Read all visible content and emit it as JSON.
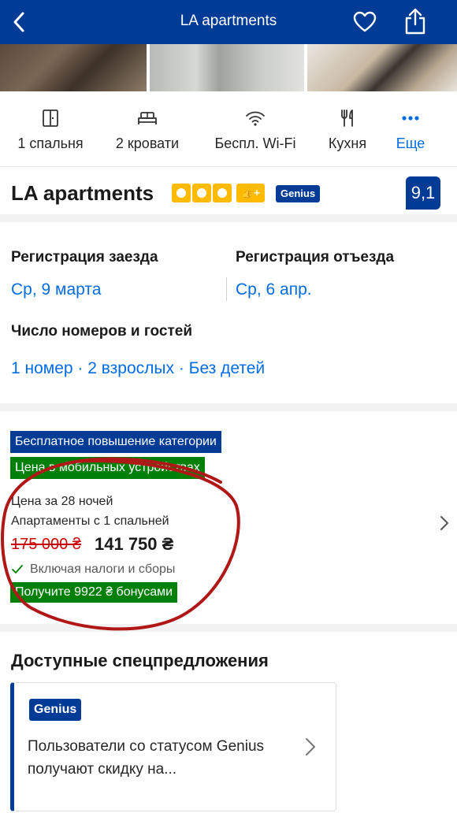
{
  "header": {
    "title": "LA apartments",
    "back_icon": "chevron-left-icon",
    "favorite_icon": "heart-icon",
    "share_icon": "share-icon",
    "background": "#003b95"
  },
  "facilities": [
    {
      "icon": "bedroom-door-icon",
      "label": "1 спальня"
    },
    {
      "icon": "bed-icon",
      "label": "2 кровати"
    },
    {
      "icon": "wifi-icon",
      "label": "Беспл. Wi-Fi"
    },
    {
      "icon": "fork-knife-icon",
      "label": "Кухня"
    },
    {
      "icon": "more-dots-icon",
      "label": "Еще"
    }
  ],
  "property": {
    "name": "LA apartments",
    "stars": 3,
    "thumb_label": "👍+",
    "genius_label": "Genius",
    "score": "9,1"
  },
  "booking": {
    "checkin_label": "Регистрация заезда",
    "checkin_value": "Ср, 9 марта",
    "checkout_label": "Регистрация отъезда",
    "checkout_value": "Ср, 6 апр.",
    "rooms_label": "Число номеров и гостей",
    "rooms_value": "1 номер · 2 взрослых · Без детей"
  },
  "price": {
    "tag_upgrade": "Бесплатное повышение категории",
    "tag_mobile": "Цена в мобильных устройствах",
    "nights": "Цена за 28 ночей",
    "room_type": "Апартаменты с 1 спальней",
    "old_price": "175 000 ₴",
    "new_price": "141 750 ₴",
    "taxes": "Включая налоги и сборы",
    "bonus": "Получите 9922 ₴ бонусами"
  },
  "deals": {
    "title": "Доступные спецпредложения",
    "card_badge": "Genius",
    "card_text": "Пользователи со статусом Genius получают скидку на..."
  },
  "colors": {
    "brand_blue": "#003b95",
    "link_blue": "#006ce4",
    "green": "#008009",
    "star_yellow": "#febb02",
    "strike_red": "#cc0000",
    "annotation_red": "#b01818"
  }
}
